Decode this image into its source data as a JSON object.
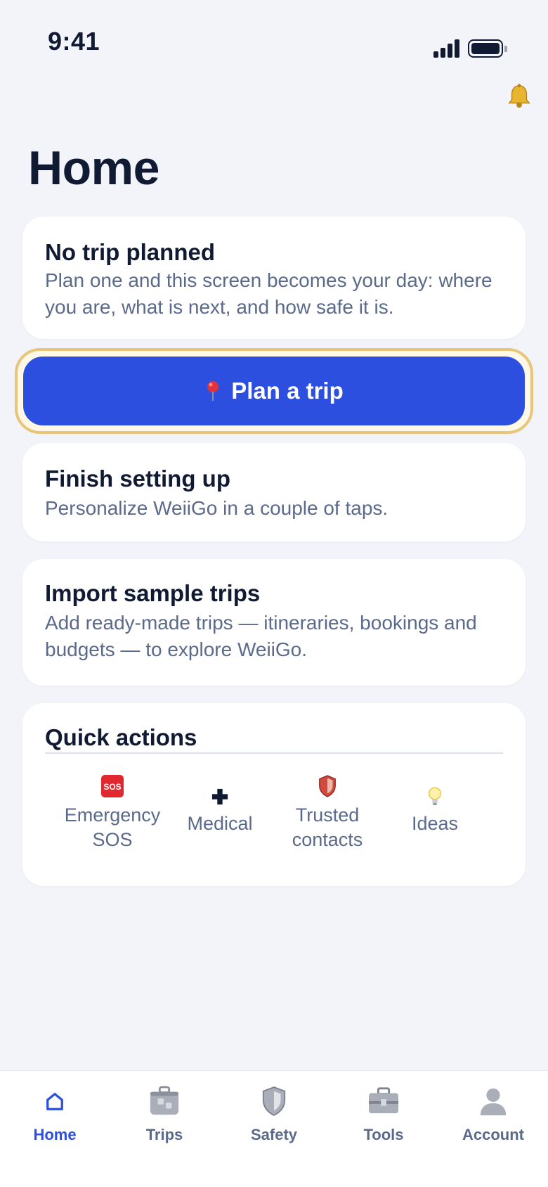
{
  "status_bar": {
    "time": "9:41"
  },
  "header": {
    "title": "Home",
    "notification_icon": "bell-icon"
  },
  "no_trip_card": {
    "title": "No trip planned",
    "text": "Plan one and this screen becomes your day: where you are, what is next, and how safe it is."
  },
  "plan_button": {
    "label": "Plan a trip",
    "icon": "pin-icon"
  },
  "setup_card": {
    "title": "Finish setting up",
    "text": "Personalize WeiiGo in a couple of taps."
  },
  "import_card": {
    "title": "Import sample trips",
    "text": "Add ready-made trips — itineraries, bookings and budgets — to explore WeiiGo."
  },
  "quick_actions": {
    "title": "Quick actions",
    "items": [
      {
        "label": "Emergency SOS",
        "icon": "sos-icon",
        "badge": "SOS"
      },
      {
        "label": "Medical",
        "icon": "medical-cross-icon"
      },
      {
        "label": "Trusted contacts",
        "icon": "shield-icon"
      },
      {
        "label": "Ideas",
        "icon": "lightbulb-icon"
      }
    ]
  },
  "tab_bar": {
    "tabs": [
      {
        "label": "Home",
        "icon": "home-icon",
        "active": true
      },
      {
        "label": "Trips",
        "icon": "luggage-icon"
      },
      {
        "label": "Safety",
        "icon": "shield-icon"
      },
      {
        "label": "Tools",
        "icon": "toolbox-icon"
      },
      {
        "label": "Account",
        "icon": "person-icon"
      }
    ]
  },
  "colors": {
    "background": "#f2f4f9",
    "accent": "#2d4fe0",
    "highlight_ring": "#e8c57a",
    "title_text": "#111a33",
    "body_text": "#5b6a8a"
  }
}
